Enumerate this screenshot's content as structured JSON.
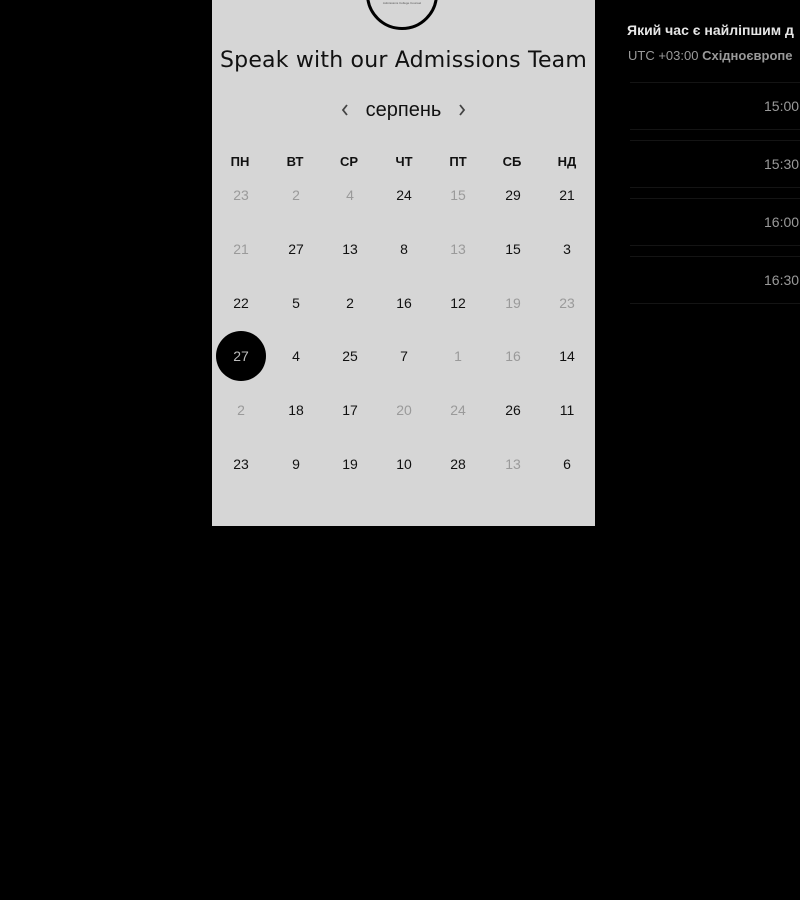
{
  "calendar": {
    "logo_text": "Admissions College Counsel",
    "title": "Speak with our Admissions Team",
    "month": "серпень",
    "prev_icon": "chevron-left-icon",
    "next_icon": "chevron-right-icon",
    "weekdays": [
      "ПН",
      "ВТ",
      "СР",
      "ЧТ",
      "ПТ",
      "СБ",
      "НД"
    ],
    "rows": [
      [
        {
          "label": "23",
          "muted": true
        },
        {
          "label": "2",
          "muted": true
        },
        {
          "label": "4",
          "muted": true
        },
        {
          "label": "24",
          "muted": false
        },
        {
          "label": "15",
          "muted": true
        },
        {
          "label": "29",
          "muted": false
        },
        {
          "label": "21",
          "muted": false
        }
      ],
      [
        {
          "label": "21",
          "muted": true
        },
        {
          "label": "27",
          "muted": false
        },
        {
          "label": "13",
          "muted": false
        },
        {
          "label": "8",
          "muted": false
        },
        {
          "label": "13",
          "muted": true
        },
        {
          "label": "15",
          "muted": false
        },
        {
          "label": "3",
          "muted": false
        }
      ],
      [
        {
          "label": "22",
          "muted": false
        },
        {
          "label": "5",
          "muted": false
        },
        {
          "label": "2",
          "muted": false
        },
        {
          "label": "16",
          "muted": false
        },
        {
          "label": "12",
          "muted": false
        },
        {
          "label": "19",
          "muted": true
        },
        {
          "label": "23",
          "muted": true
        }
      ],
      [
        {
          "label": "27",
          "muted": false,
          "selected": true
        },
        {
          "label": "4",
          "muted": false
        },
        {
          "label": "25",
          "muted": false
        },
        {
          "label": "7",
          "muted": false
        },
        {
          "label": "1",
          "muted": true
        },
        {
          "label": "16",
          "muted": true
        },
        {
          "label": "14",
          "muted": false
        }
      ],
      [
        {
          "label": "2",
          "muted": true
        },
        {
          "label": "18",
          "muted": false
        },
        {
          "label": "17",
          "muted": false
        },
        {
          "label": "20",
          "muted": true
        },
        {
          "label": "24",
          "muted": true
        },
        {
          "label": "26",
          "muted": false
        },
        {
          "label": "11",
          "muted": false
        }
      ],
      [
        {
          "label": "23",
          "muted": false
        },
        {
          "label": "9",
          "muted": false
        },
        {
          "label": "19",
          "muted": false
        },
        {
          "label": "10",
          "muted": false
        },
        {
          "label": "28",
          "muted": false
        },
        {
          "label": "13",
          "muted": true
        },
        {
          "label": "6",
          "muted": false
        }
      ]
    ]
  },
  "times": {
    "heading": "Який час є найліпшим д",
    "timezone_prefix": "UTC +03:00 ",
    "timezone_name": "Східноєвропе",
    "slots": [
      "15:00",
      "15:30",
      "16:00",
      "16:30"
    ]
  },
  "colors": {
    "panel_bg": "#d6d6d6",
    "page_bg": "#000000",
    "selected_bg": "#000000",
    "muted_text": "#9a9a9a"
  }
}
